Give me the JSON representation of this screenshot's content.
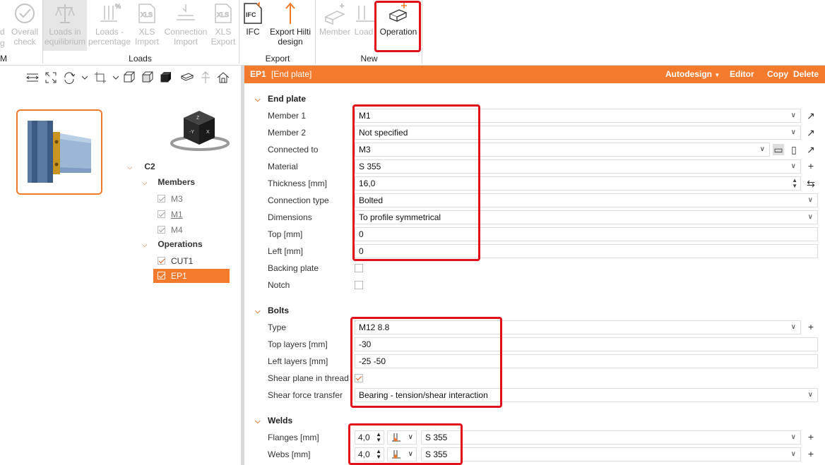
{
  "ribbon": {
    "partial_left_top": "d",
    "partial_left_bottom": "g",
    "overall_check": "Overall check",
    "loads_in_equilibrium": "Loads in equilibrium",
    "loads_percentage": "Loads - percentage",
    "xls_import": "XLS Import",
    "connection_import": "Connection Import",
    "xls_export": "XLS Export",
    "ifc": "IFC",
    "export_hilti": "Export Hilti design",
    "member": "Member",
    "load": "Load",
    "operation": "Operation",
    "group_partial": "M",
    "group_loads": "Loads",
    "group_export": "Export",
    "group_new": "New"
  },
  "tree": {
    "root": "C2",
    "members_label": "Members",
    "members": [
      "M3",
      "M1",
      "M4"
    ],
    "operations_label": "Operations",
    "operations": [
      "CUT1",
      "EP1"
    ]
  },
  "header": {
    "name": "EP1",
    "desc": "[End plate]",
    "autodesign": "Autodesign",
    "editor": "Editor",
    "copy": "Copy",
    "delete": "Delete"
  },
  "end_plate": {
    "title": "End plate",
    "member1_label": "Member 1",
    "member1": "M1",
    "member2_label": "Member 2",
    "member2": "Not specified",
    "connected_to_label": "Connected to",
    "connected_to": "M3",
    "material_label": "Material",
    "material": "S 355",
    "thickness_label": "Thickness [mm]",
    "thickness": "16,0",
    "connection_type_label": "Connection type",
    "connection_type": "Bolted",
    "dimensions_label": "Dimensions",
    "dimensions": "To profile symmetrical",
    "top_label": "Top [mm]",
    "top": "0",
    "left_label": "Left [mm]",
    "left": "0",
    "backing_plate_label": "Backing plate",
    "notch_label": "Notch"
  },
  "bolts": {
    "title": "Bolts",
    "type_label": "Type",
    "type": "M12 8.8",
    "top_layers_label": "Top layers [mm]",
    "top_layers": "-30",
    "left_layers_label": "Left layers [mm]",
    "left_layers": "-25 -50",
    "shear_plane_label": "Shear plane in thread",
    "shear_force_label": "Shear force transfer",
    "shear_force": "Bearing - tension/shear interaction"
  },
  "welds": {
    "title": "Welds",
    "flanges_label": "Flanges [mm]",
    "flanges_size": "4,0",
    "flanges_material": "S 355",
    "webs_label": "Webs [mm]",
    "webs_size": "4,0",
    "webs_material": "S 355"
  },
  "colors": {
    "accent": "#f47a2d",
    "highlight": "#e0101a"
  }
}
